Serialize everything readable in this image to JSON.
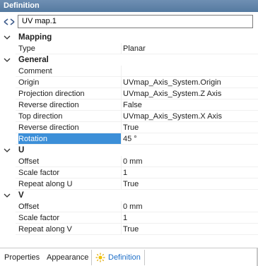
{
  "panel": {
    "title": "Definition"
  },
  "name_field": {
    "value": "UV map.1"
  },
  "categories": [
    {
      "label": "Mapping",
      "rows": [
        {
          "name": "Type",
          "value": "Planar"
        }
      ]
    },
    {
      "label": "General",
      "rows": [
        {
          "name": "Comment",
          "value": ""
        },
        {
          "name": "Origin",
          "value": "UVmap_Axis_System.Origin"
        },
        {
          "name": "Projection direction",
          "value": "UVmap_Axis_System.Z Axis"
        },
        {
          "name": "Reverse direction",
          "value": "False"
        },
        {
          "name": "Top direction",
          "value": "UVmap_Axis_System.X Axis"
        },
        {
          "name": "Reverse direction",
          "value": "True"
        },
        {
          "name": "Rotation",
          "value": "45 °",
          "selected": true
        }
      ]
    },
    {
      "label": "U",
      "rows": [
        {
          "name": "Offset",
          "value": "0 mm"
        },
        {
          "name": "Scale factor",
          "value": "1"
        },
        {
          "name": "Repeat along U",
          "value": "True"
        }
      ]
    },
    {
      "label": "V",
      "rows": [
        {
          "name": "Offset",
          "value": "0 mm"
        },
        {
          "name": "Scale factor",
          "value": "1"
        },
        {
          "name": "Repeat along V",
          "value": "True"
        }
      ]
    }
  ],
  "tabs": [
    {
      "label": "Properties"
    },
    {
      "label": "Appearance"
    },
    {
      "label": "Definition",
      "active": true,
      "icon": "sun-icon"
    }
  ],
  "colors": {
    "selection": "#3c8fd8",
    "active_tab": "#1e6fc8",
    "title_bar": "#6484aa"
  }
}
